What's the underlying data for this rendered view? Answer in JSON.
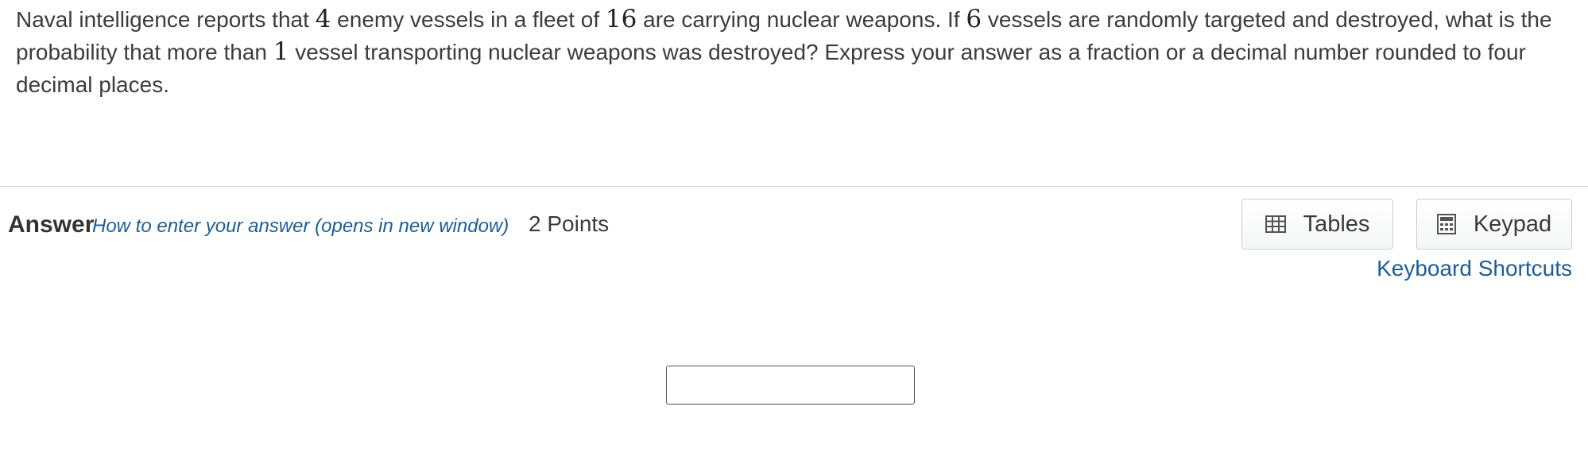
{
  "question": {
    "part1": "Naval intelligence reports that ",
    "n_nuclear": "4",
    "part2": " enemy vessels in a fleet of ",
    "n_fleet": "16",
    "part3": " are carrying nuclear weapons. If ",
    "n_targeted": "6",
    "part4": " vessels are randomly targeted and destroyed, what is the probability that more than ",
    "n_threshold": "1",
    "part5": " vessel transporting nuclear weapons was destroyed? Express your answer as a fraction or a decimal number rounded to four decimal places."
  },
  "answer": {
    "label": "Answer",
    "help_link": "How to enter your answer (opens in new window)",
    "points": "2 Points",
    "input_value": ""
  },
  "tools": {
    "tables_label": "Tables",
    "tables_icon": "table-icon",
    "keypad_label": "Keypad",
    "keypad_icon": "calculator-icon",
    "shortcuts_label": "Keyboard Shortcuts"
  },
  "colors": {
    "link": "#1a5e9a",
    "text": "#3b3b3b",
    "divider": "#d4d4d4"
  }
}
